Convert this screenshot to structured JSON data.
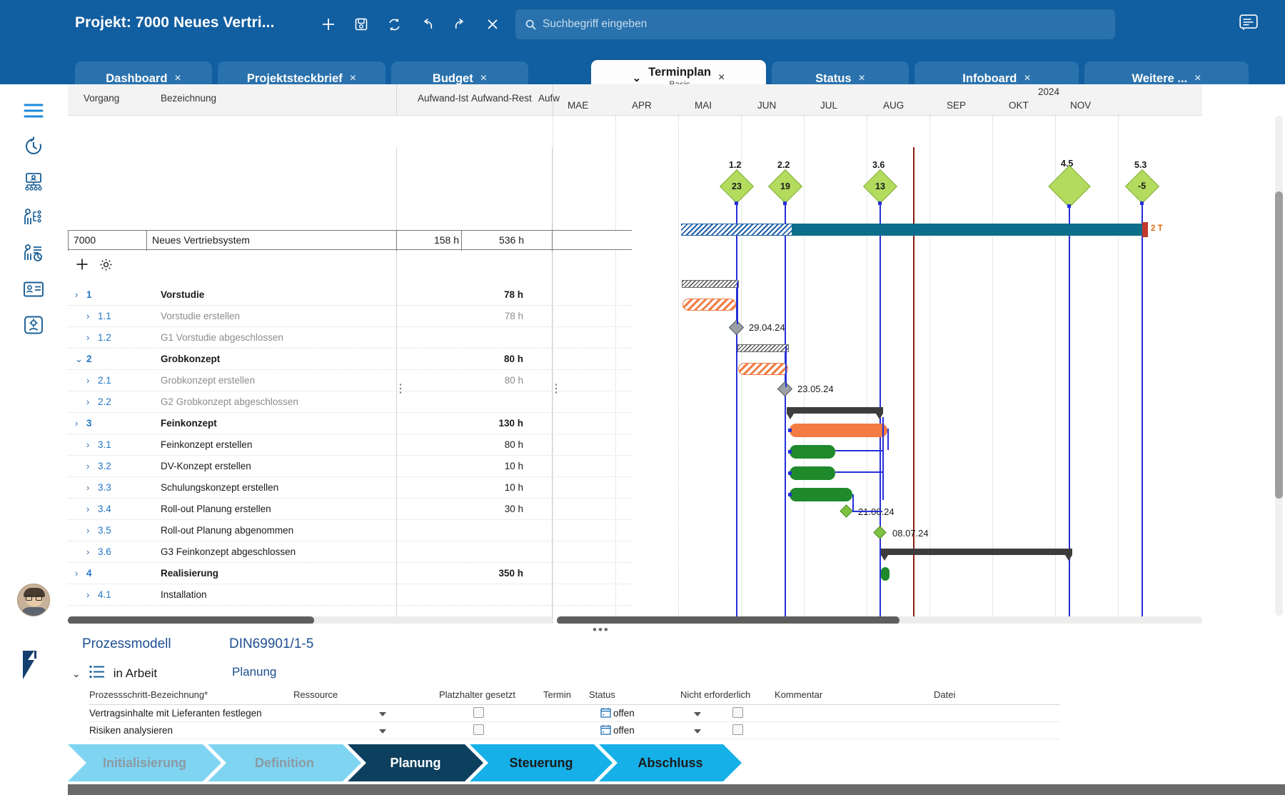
{
  "header": {
    "title": "Projekt: 7000 Neues Vertri...",
    "icons": [
      "plus-icon",
      "save-icon",
      "refresh-icon",
      "undo-icon",
      "redo-icon",
      "close-icon",
      "home-icon"
    ],
    "search_placeholder": "Suchbegriff eingeben",
    "search_value": "",
    "feedback_icon": "feedback-icon",
    "bg_color": "#115ea0"
  },
  "tabs": [
    {
      "label": "Dashboard",
      "active": false,
      "close": "×"
    },
    {
      "label": "Projektsteckbrief",
      "active": false,
      "close": "×"
    },
    {
      "label": "Budget",
      "active": false,
      "close": "×"
    },
    {
      "label": "Terminplan",
      "sublabel": "Basis",
      "active": true,
      "close": "×",
      "chevron": "⌄"
    },
    {
      "label": "Status",
      "active": false,
      "close": "×"
    },
    {
      "label": "Infoboard",
      "active": false,
      "close": "×"
    },
    {
      "label": "Weitere ...",
      "active": false,
      "close": "×"
    }
  ],
  "rail": {
    "items": [
      {
        "name": "menu-icon",
        "label": "Menü"
      },
      {
        "name": "history-icon",
        "label": "Historie"
      },
      {
        "name": "org-structure-icon",
        "label": "Projektstruktur"
      },
      {
        "name": "resource-assignment-icon",
        "label": "Ressourcen"
      },
      {
        "name": "resource-report-icon",
        "label": "Auswertung"
      },
      {
        "name": "contact-card-icon",
        "label": "Kontakte"
      },
      {
        "name": "settings-user-icon",
        "label": "Einstellungen"
      }
    ]
  },
  "grid": {
    "columns": [
      {
        "key": "vorgang",
        "label": "Vorgang"
      },
      {
        "key": "bezeichnung",
        "label": "Bezeichnung"
      },
      {
        "key": "aufwand_ist",
        "label": "Aufwand-Ist"
      },
      {
        "key": "aufwand_rest",
        "label": "Aufwand-Rest"
      },
      {
        "key": "aufwand_trunc",
        "label": "Aufw"
      }
    ],
    "project_row": {
      "id": "7000",
      "name": "Neues Vertriebsystem",
      "aufwand_ist": "158 h",
      "aufwand_rest": "536 h"
    },
    "toolbar": {
      "add": "+",
      "settings": "gear-icon"
    },
    "rows": [
      {
        "toggle": "›",
        "wbs": "1",
        "level": 0,
        "name": "Vorstudie",
        "effort": "78 h",
        "bold": true,
        "muted": false
      },
      {
        "toggle": "›",
        "wbs": "1.1",
        "level": 1,
        "name": "Vorstudie erstellen",
        "effort": "78 h",
        "bold": false,
        "muted": true
      },
      {
        "toggle": "›",
        "wbs": "1.2",
        "level": 1,
        "name": "G1 Vorstudie abgeschlossen",
        "effort": "",
        "bold": false,
        "muted": true
      },
      {
        "toggle": "⌄",
        "wbs": "2",
        "level": 0,
        "name": "Grobkonzept",
        "effort": "80 h",
        "bold": true,
        "muted": false
      },
      {
        "toggle": "›",
        "wbs": "2.1",
        "level": 1,
        "name": "Grobkonzept erstellen",
        "effort": "80 h",
        "bold": false,
        "muted": true
      },
      {
        "toggle": "›",
        "wbs": "2.2",
        "level": 1,
        "name": "G2 Grobkonzept abgeschlossen",
        "effort": "",
        "bold": false,
        "muted": true
      },
      {
        "toggle": "›",
        "wbs": "3",
        "level": 0,
        "name": "Feinkonzept",
        "effort": "130 h",
        "bold": true,
        "muted": false
      },
      {
        "toggle": "›",
        "wbs": "3.1",
        "level": 1,
        "name": "Feinkonzept erstellen",
        "effort": "80 h",
        "bold": false,
        "muted": false
      },
      {
        "toggle": "›",
        "wbs": "3.2",
        "level": 1,
        "name": "DV-Konzept erstellen",
        "effort": "10 h",
        "bold": false,
        "muted": false
      },
      {
        "toggle": "›",
        "wbs": "3.3",
        "level": 1,
        "name": "Schulungskonzept erstellen",
        "effort": "10 h",
        "bold": false,
        "muted": false
      },
      {
        "toggle": "›",
        "wbs": "3.4",
        "level": 1,
        "name": "Roll-out Planung erstellen",
        "effort": "30 h",
        "bold": false,
        "muted": false
      },
      {
        "toggle": "›",
        "wbs": "3.5",
        "level": 1,
        "name": "Roll-out Planung abgenommen",
        "effort": "",
        "bold": false,
        "muted": false
      },
      {
        "toggle": "›",
        "wbs": "3.6",
        "level": 1,
        "name": "G3 Feinkonzept abgeschlossen",
        "effort": "",
        "bold": false,
        "muted": false
      },
      {
        "toggle": "›",
        "wbs": "4",
        "level": 0,
        "name": "Realisierung",
        "effort": "350 h",
        "bold": true,
        "muted": false
      },
      {
        "toggle": "›",
        "wbs": "4.1",
        "level": 1,
        "name": "Installation",
        "effort": "",
        "bold": false,
        "muted": false
      }
    ]
  },
  "timeline": {
    "year": "2024",
    "months": [
      "MAE",
      "APR",
      "MAI",
      "JUN",
      "JUL",
      "AUG",
      "SEP",
      "OKT",
      "NOV"
    ],
    "today_marker_month": "JUL",
    "top_milestones": [
      {
        "label": "1.2",
        "value": "23",
        "month": "APR"
      },
      {
        "label": "2.2",
        "value": "19",
        "month": "MAI"
      },
      {
        "label": "3.6",
        "value": "13",
        "month": "JUL"
      },
      {
        "label": "4.5",
        "value": "",
        "month": "OKT"
      },
      {
        "label": "5.3",
        "value": "-5",
        "month": "NOV"
      }
    ],
    "bar_end_badge": "2 T",
    "gantt_milestones": [
      {
        "date": "29.04.24",
        "type": "grey"
      },
      {
        "date": "23.05.24",
        "type": "grey"
      },
      {
        "date": "21.06.24",
        "type": "green"
      },
      {
        "date": "08.07.24",
        "type": "green"
      }
    ]
  },
  "process": {
    "title": "Prozessmodell",
    "norm": "DIN69901/1-5",
    "state_icon": "list-icon",
    "state_chevron": "⌄",
    "state": "in Arbeit",
    "phase": "Planung",
    "columns": [
      "Prozessschritt-Bezeichnung*",
      "Ressource",
      "Platzhalter gesetzt",
      "Termin",
      "Status",
      "Nicht erforderlich",
      "Kommentar",
      "Datei"
    ],
    "rows": [
      {
        "name": "Vertragsinhalte mit Lieferanten festlegen",
        "ressource": "",
        "platzhalter": false,
        "termin": "",
        "status": "offen",
        "nicht_erforderlich": false,
        "kommentar": "",
        "datei": ""
      },
      {
        "name": "Risiken analysieren",
        "ressource": "",
        "platzhalter": false,
        "termin": "",
        "status": "offen",
        "nicht_erforderlich": false,
        "kommentar": "",
        "datei": ""
      }
    ]
  },
  "phases": [
    {
      "label": "Initialisierung",
      "state": "done"
    },
    {
      "label": "Definition",
      "state": "done"
    },
    {
      "label": "Planung",
      "state": "active"
    },
    {
      "label": "Steuerung",
      "state": "next"
    },
    {
      "label": "Abschluss",
      "state": "next"
    }
  ],
  "colors": {
    "brand_blue": "#115ea0",
    "tab_blue": "#2a72ad",
    "milestone_green": "#b3db5e",
    "bar_teal": "#0d6e8c",
    "bar_orange": "#f47b43",
    "bar_green": "#1f8a2b",
    "today_red": "#8c1c13",
    "link_blue": "#2630d8",
    "phase_active": "#0d3f5e",
    "phase_next": "#16b0e8",
    "phase_done": "#7fd4f2"
  }
}
